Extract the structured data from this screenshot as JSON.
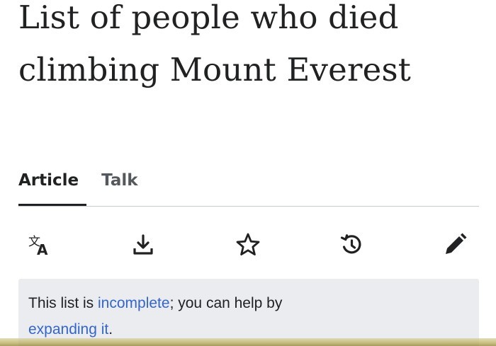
{
  "page": {
    "title": "List of people who died climbing Mount Everest"
  },
  "tabs": [
    {
      "label": "Article",
      "active": true
    },
    {
      "label": "Talk",
      "active": false
    }
  ],
  "toolbar": {
    "icons": [
      "language-icon",
      "download-icon",
      "star-icon",
      "history-icon",
      "edit-pencil-icon"
    ]
  },
  "notice": {
    "text_before": "This list is ",
    "link1": "incomplete",
    "text_middle": "; you can help by ",
    "link2": "expanding it",
    "text_after": "."
  },
  "colors": {
    "text": "#202122",
    "link": "#3366cc",
    "notice_bg": "#eaecf0",
    "divider": "#c8ccd1"
  }
}
